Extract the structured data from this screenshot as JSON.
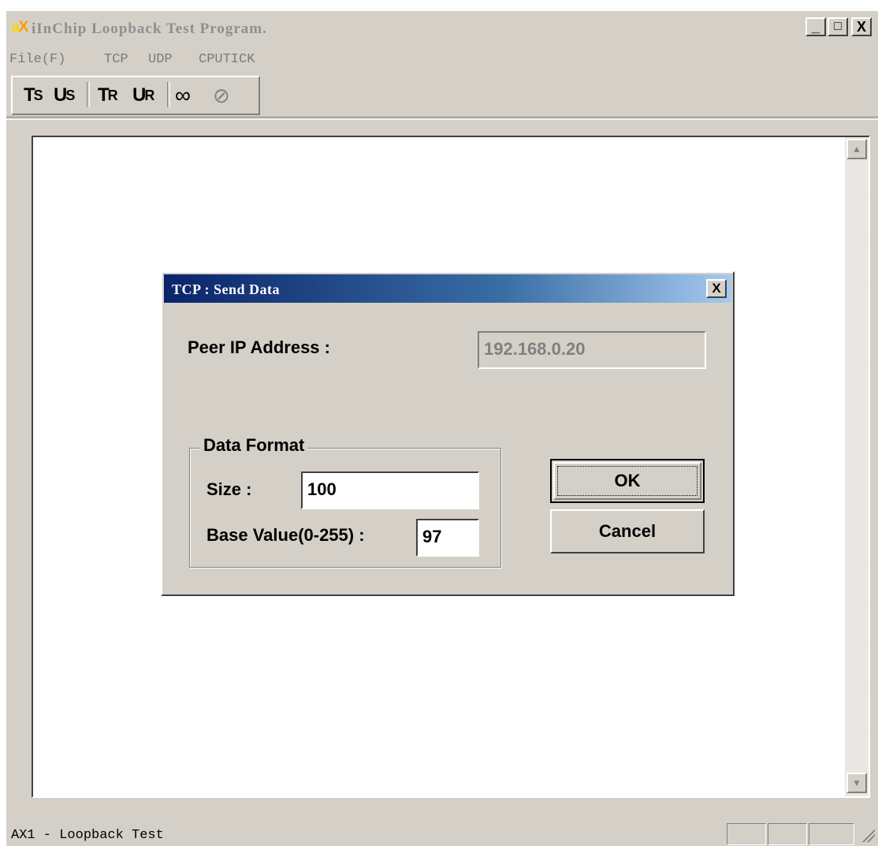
{
  "window": {
    "logo": {
      "a": "a",
      "x": "X"
    },
    "title": "iInChip Loopback Test Program.",
    "controls": {
      "minimize": "_",
      "maximize": "□",
      "close": "X"
    }
  },
  "menu": [
    "File(F)",
    "TCP",
    "UDP",
    "CPUTICK"
  ],
  "toolbar": {
    "tcp_send": {
      "main": "T",
      "sub": "S"
    },
    "udp_send": {
      "main": "U",
      "sub": "S"
    },
    "tcp_recv": {
      "main": "T",
      "sub": "R"
    },
    "udp_recv": {
      "main": "U",
      "sub": "R"
    },
    "loop": "∞",
    "stop": "⊘"
  },
  "dialog": {
    "title": "TCP : Send Data",
    "close": "X",
    "peer_ip_label": "Peer IP Address :",
    "peer_ip_value": "192.168.0.20",
    "group_label": "Data Format",
    "size_label": "Size :",
    "size_value": "100",
    "base_label": "Base Value(0-255) :",
    "base_value": "97",
    "ok_label": "OK",
    "cancel_label": "Cancel"
  },
  "statusbar": {
    "text": "AX1 - Loopback Test"
  },
  "scrollbar": {
    "up": "▲",
    "down": "▼"
  }
}
